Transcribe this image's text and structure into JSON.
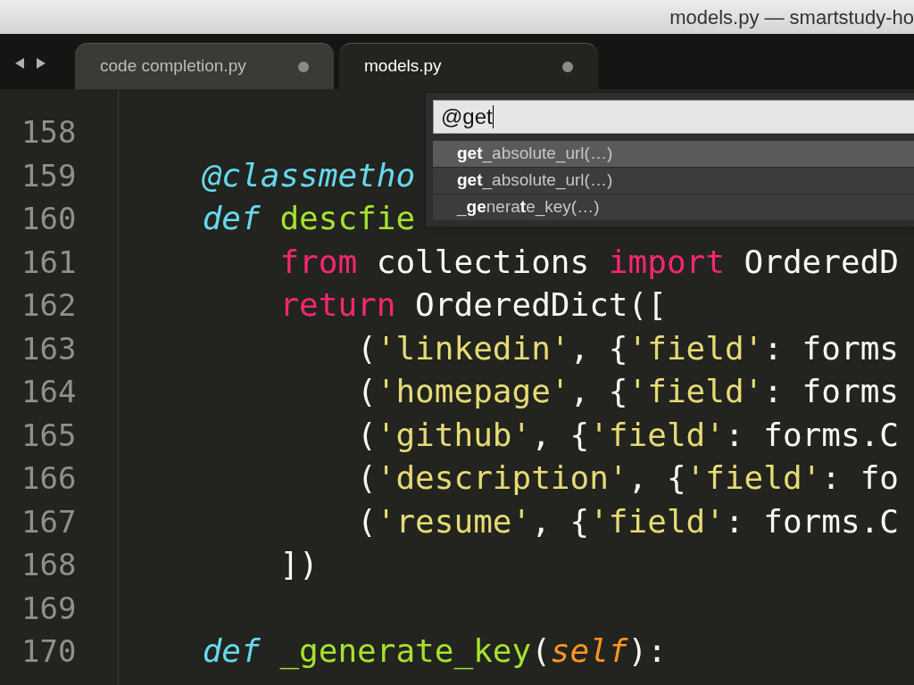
{
  "window": {
    "title": "models.py — smartstudy-ho"
  },
  "tabs": [
    {
      "label": "code completion.py",
      "selected": false,
      "modified": true
    },
    {
      "label": "models.py",
      "selected": true,
      "modified": true
    }
  ],
  "editor": {
    "lines": [
      {
        "number": "158"
      },
      {
        "number": "159",
        "tokens": [
          {
            "kind": "decorator",
            "text": "    @classmetho"
          }
        ]
      },
      {
        "number": "160",
        "tokens": [
          {
            "kind": "storage",
            "text": "    def "
          },
          {
            "kind": "function",
            "text": "descfie"
          }
        ]
      },
      {
        "number": "161",
        "tokens": [
          {
            "kind": "keyword",
            "text": "        from"
          },
          {
            "kind": "plain",
            "text": " collections "
          },
          {
            "kind": "keyword",
            "text": "import"
          },
          {
            "kind": "plain",
            "text": " OrderedD"
          }
        ]
      },
      {
        "number": "162",
        "tokens": [
          {
            "kind": "keyword",
            "text": "        return"
          },
          {
            "kind": "plain",
            "text": " OrderedDict(["
          }
        ]
      },
      {
        "number": "163",
        "tokens": [
          {
            "kind": "plain",
            "text": "            ("
          },
          {
            "kind": "string",
            "text": "'linkedin'"
          },
          {
            "kind": "plain",
            "text": ", {"
          },
          {
            "kind": "string",
            "text": "'field'"
          },
          {
            "kind": "plain",
            "text": ": forms"
          }
        ]
      },
      {
        "number": "164",
        "tokens": [
          {
            "kind": "plain",
            "text": "            ("
          },
          {
            "kind": "string",
            "text": "'homepage'"
          },
          {
            "kind": "plain",
            "text": ", {"
          },
          {
            "kind": "string",
            "text": "'field'"
          },
          {
            "kind": "plain",
            "text": ": forms"
          }
        ]
      },
      {
        "number": "165",
        "tokens": [
          {
            "kind": "plain",
            "text": "            ("
          },
          {
            "kind": "string",
            "text": "'github'"
          },
          {
            "kind": "plain",
            "text": ", {"
          },
          {
            "kind": "string",
            "text": "'field'"
          },
          {
            "kind": "plain",
            "text": ": forms.C"
          }
        ]
      },
      {
        "number": "166",
        "tokens": [
          {
            "kind": "plain",
            "text": "            ("
          },
          {
            "kind": "string",
            "text": "'description'"
          },
          {
            "kind": "plain",
            "text": ", {"
          },
          {
            "kind": "string",
            "text": "'field'"
          },
          {
            "kind": "plain",
            "text": ": fo"
          }
        ]
      },
      {
        "number": "167",
        "tokens": [
          {
            "kind": "plain",
            "text": "            ("
          },
          {
            "kind": "string",
            "text": "'resume'"
          },
          {
            "kind": "plain",
            "text": ", {"
          },
          {
            "kind": "string",
            "text": "'field'"
          },
          {
            "kind": "plain",
            "text": ": forms.C"
          }
        ]
      },
      {
        "number": "168",
        "tokens": [
          {
            "kind": "plain",
            "text": "        ])"
          }
        ]
      },
      {
        "number": "169"
      },
      {
        "number": "170",
        "tokens": [
          {
            "kind": "storage",
            "text": "    def "
          },
          {
            "kind": "function",
            "text": "_generate_key"
          },
          {
            "kind": "plain",
            "text": "("
          },
          {
            "kind": "param",
            "text": "self"
          },
          {
            "kind": "plain",
            "text": "):"
          }
        ]
      }
    ]
  },
  "completion": {
    "query": "@get",
    "items": [
      {
        "label": "**get**_absolute_url(…)",
        "selected": true
      },
      {
        "label": "**get**_absolute_url(…)",
        "selected": false
      },
      {
        "label": "_**ge**nera**t**e_key(…)",
        "selected": false
      }
    ]
  }
}
